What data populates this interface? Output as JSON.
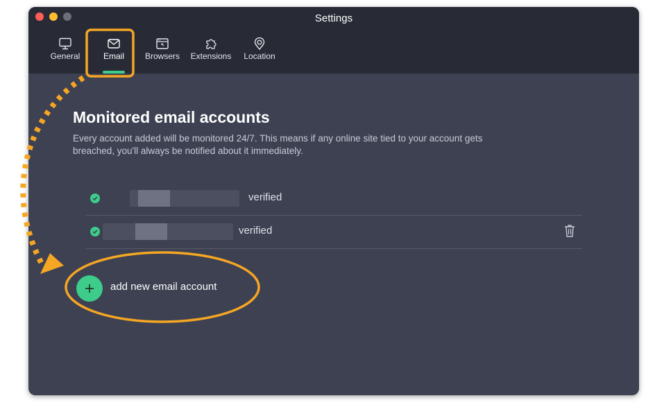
{
  "window": {
    "title": "Settings"
  },
  "tabs": [
    {
      "label": "General",
      "icon": "monitor-icon"
    },
    {
      "label": "Email",
      "icon": "envelope-icon"
    },
    {
      "label": "Browsers",
      "icon": "browser-window-icon"
    },
    {
      "label": "Extensions",
      "icon": "puzzle-icon"
    },
    {
      "label": "Location",
      "icon": "location-pin-icon"
    }
  ],
  "active_tab": "Email",
  "main": {
    "heading": "Monitored email accounts",
    "description": "Every account added will be monitored 24/7. This means if any online site tied to your account gets breached, you'll always be notified about it immediately.",
    "accounts": [
      {
        "status": "verified"
      },
      {
        "status": "verified"
      }
    ],
    "add_label": "add new email account"
  },
  "colors": {
    "accent_green": "#3dcc8a",
    "highlight_orange": "#f5a623",
    "background": "#3d4152",
    "titlebar": "#282b36"
  }
}
